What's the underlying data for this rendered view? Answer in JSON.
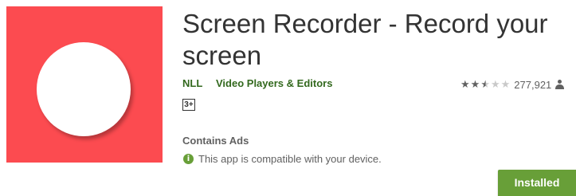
{
  "app": {
    "icon": "screen-recorder-app-icon",
    "title": "Screen Recorder - Record your screen",
    "developer": "NLL",
    "category": "Video Players & Editors",
    "rating": {
      "stars": 2.5,
      "max_stars": 5,
      "count": "277,921"
    },
    "content_rating": "3+",
    "contains_ads": "Contains Ads",
    "compatibility": "This app is compatible with your device.",
    "install_label": "Installed"
  },
  "colors": {
    "icon_background": "#fc4b50",
    "link_green": "#33691e",
    "button_green": "#689f38",
    "text_primary": "#333333",
    "text_secondary": "#616161"
  }
}
